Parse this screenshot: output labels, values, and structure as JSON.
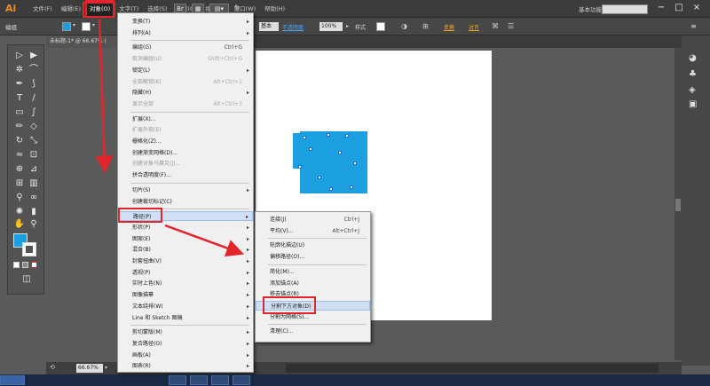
{
  "app": {
    "logo": "Ai"
  },
  "menubar": {
    "items": [
      "文件(F)",
      "编辑(E)",
      "对象(O)",
      "文字(T)",
      "选择(S)",
      "效果(C)",
      "视图(V)",
      "窗口(W)",
      "帮助(H)"
    ],
    "br_label": "Br",
    "workspace": "基本功能",
    "window_controls": [
      "−",
      "□",
      "×"
    ]
  },
  "controlbar": {
    "selection_label": "编组",
    "stroke_style": "基本",
    "opacity_label": "不透明度",
    "opacity_value": "100%",
    "style_label": "样式",
    "transform_label": "变换",
    "align_label": "对齐",
    "fill_color": "#1b9fe0"
  },
  "document": {
    "tab_title": "未标题-1* @ 66.67% (",
    "zoom": "66.67%"
  },
  "object_menu": [
    {
      "label": "变换(T)",
      "sub": true
    },
    {
      "label": "排列(A)",
      "sub": true
    },
    {
      "sep": true
    },
    {
      "label": "编组(G)",
      "shortcut": "Ctrl+G"
    },
    {
      "label": "取消编组(U)",
      "shortcut": "Shift+Ctrl+G",
      "disabled": true
    },
    {
      "label": "锁定(L)",
      "sub": true
    },
    {
      "label": "全部解锁(K)",
      "shortcut": "Alt+Ctrl+2",
      "disabled": true
    },
    {
      "label": "隐藏(H)",
      "sub": true
    },
    {
      "label": "显示全部",
      "shortcut": "Alt+Ctrl+3",
      "disabled": true
    },
    {
      "sep": true
    },
    {
      "label": "扩展(X)..."
    },
    {
      "label": "扩展外观(E)",
      "disabled": true
    },
    {
      "label": "栅格化(Z)..."
    },
    {
      "label": "创建渐变网格(D)..."
    },
    {
      "label": "创建对象马赛克(J)...",
      "disabled": true
    },
    {
      "label": "拼合透明度(F)..."
    },
    {
      "sep": true
    },
    {
      "label": "切片(S)",
      "sub": true
    },
    {
      "label": "创建裁切标记(C)"
    },
    {
      "sep": true
    },
    {
      "label": "路径(P)",
      "sub": true,
      "highlight": true
    },
    {
      "label": "形状(P)",
      "sub": true
    },
    {
      "label": "图案(E)",
      "sub": true
    },
    {
      "label": "混合(B)",
      "sub": true
    },
    {
      "label": "封套扭曲(V)",
      "sub": true
    },
    {
      "label": "透视(P)",
      "sub": true
    },
    {
      "label": "实时上色(N)",
      "sub": true
    },
    {
      "label": "图像描摹",
      "sub": true
    },
    {
      "label": "文本绕排(W)",
      "sub": true
    },
    {
      "label": "Line 和 Sketch 图稿",
      "sub": true
    },
    {
      "sep": true
    },
    {
      "label": "剪切蒙版(M)",
      "sub": true
    },
    {
      "label": "复合路径(O)",
      "sub": true
    },
    {
      "label": "画板(A)",
      "sub": true
    },
    {
      "label": "图表(R)",
      "sub": true
    }
  ],
  "path_submenu": [
    {
      "label": "连接(J)",
      "shortcut": "Ctrl+J"
    },
    {
      "label": "平均(V)...",
      "shortcut": "Alt+Ctrl+J"
    },
    {
      "sep": true
    },
    {
      "label": "轮廓化描边(U)"
    },
    {
      "label": "偏移路径(O)..."
    },
    {
      "sep": true
    },
    {
      "label": "简化(M)..."
    },
    {
      "label": "添加锚点(A)"
    },
    {
      "label": "移去锚点(R)"
    },
    {
      "label": "分割下方对象(D)",
      "highlight": true
    },
    {
      "label": "分割为网格(S)..."
    },
    {
      "sep": true
    },
    {
      "label": "清理(C)..."
    }
  ]
}
